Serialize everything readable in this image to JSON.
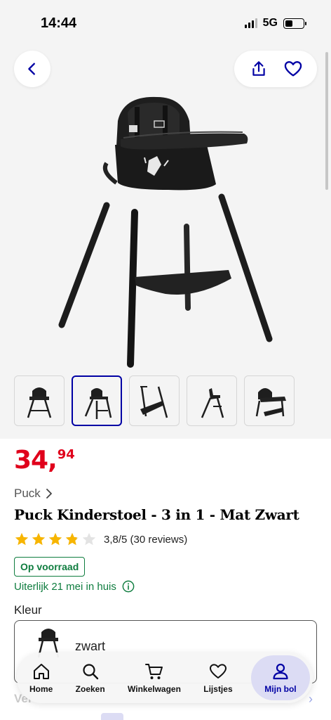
{
  "status_bar": {
    "time": "14:44",
    "network": "5G"
  },
  "colors": {
    "brand_blue": "#0000a4",
    "price_red": "#e0001b",
    "stock_green": "#0f7d3f",
    "star_yellow": "#f7b500"
  },
  "header": {
    "back_icon": "chevron-left-icon",
    "share_icon": "share-icon",
    "wishlist_icon": "heart-icon"
  },
  "gallery": {
    "active_index": 1,
    "thumbnails": [
      "thumb-chair-front",
      "thumb-chair-angle",
      "thumb-chair-parts",
      "thumb-chair-side",
      "thumb-chair-tray"
    ]
  },
  "product": {
    "price_main": "34,",
    "price_cents": "94",
    "brand": "Puck",
    "title": "Puck Kinderstoel - 3 in 1 - Mat Zwart",
    "rating_value": 3.8,
    "rating_text": "3,8/5 (30 reviews)",
    "stock": "Op voorraad",
    "delivery": "Uiterlijk 21 mei in huis"
  },
  "variant": {
    "label": "Kleur",
    "selected": "zwart"
  },
  "bottom_nav": {
    "items": [
      {
        "label": "Home",
        "icon": "home-icon"
      },
      {
        "label": "Zoeken",
        "icon": "search-icon"
      },
      {
        "label": "Winkelwagen",
        "icon": "cart-icon"
      },
      {
        "label": "Lijstjes",
        "icon": "heart-icon"
      },
      {
        "label": "Mijn bol",
        "icon": "user-icon"
      }
    ],
    "active": "Mijn bol"
  },
  "behind_nav": {
    "text": "Ver"
  }
}
